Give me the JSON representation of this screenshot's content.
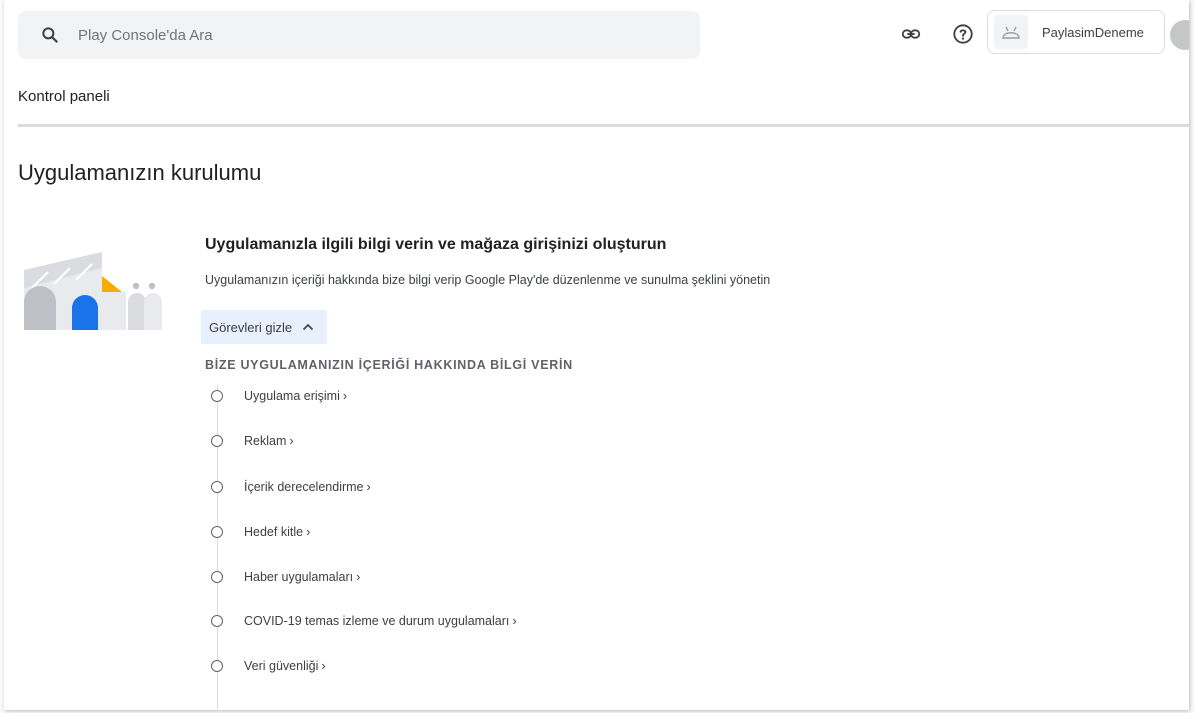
{
  "search": {
    "placeholder": "Play Console'da Ara"
  },
  "header": {
    "app_name": "PaylasimDeneme"
  },
  "breadcrumb": "Kontrol paneli",
  "section_title": "Uygulamanızın kurulumu",
  "card": {
    "title": "Uygulamanızla ilgili bilgi verin ve mağaza girişinizi oluşturun",
    "description": "Uygulamanızın içeriği hakkında bize bilgi verip Google Play'de düzenlenme ve sunulma şeklini yönetin",
    "toggle_label": "Görevleri gizle",
    "group_heading": "BİZE UYGULAMANIZIN İÇERİĞİ HAKKINDA BİLGİ VERİN",
    "tasks": [
      {
        "label": "Uygulama erişimi"
      },
      {
        "label": "Reklam"
      },
      {
        "label": "İçerik derecelendirme"
      },
      {
        "label": "Hedef kitle"
      },
      {
        "label": "Haber uygulamaları"
      },
      {
        "label": "COVID-19 temas izleme ve durum uygulamaları"
      },
      {
        "label": "Veri güvenliği"
      }
    ],
    "task_chevron": "›"
  },
  "icons": {
    "search": "search-icon",
    "link": "link-icon",
    "help": "help-icon",
    "app": "android-icon",
    "chevron": "chevron-up-icon"
  },
  "colors": {
    "toggle_bg": "#e8f0fe",
    "accent_blue": "#1a73e8",
    "illustration_yellow": "#f9ab00"
  }
}
